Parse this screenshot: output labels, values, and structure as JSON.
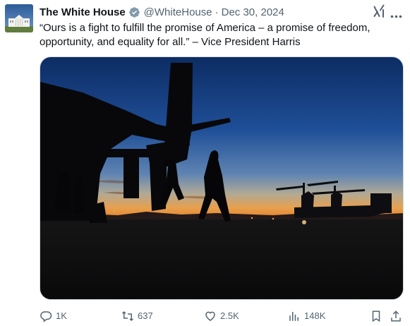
{
  "tweet": {
    "display_name": "The White House",
    "handle": "@WhiteHouse",
    "separator": "·",
    "date": "Dec 30, 2024",
    "text": "“Ours is a fight to fulfill the promise of America – a promise of freedom, opportunity, and equality for all.” – Vice President Harris",
    "icons": {
      "verified": "verified-badge-icon",
      "grok": "grok-icon",
      "more": "more-options-icon"
    },
    "colors": {
      "text": "#0f1419",
      "secondary": "#536471",
      "verified_badge": "#829aab"
    }
  },
  "actions": {
    "replies": "1K",
    "reposts": "637",
    "likes": "2.5K",
    "views": "148K",
    "icons": [
      "reply-icon",
      "repost-icon",
      "like-icon",
      "views-icon",
      "bookmark-icon",
      "share-icon"
    ]
  }
}
